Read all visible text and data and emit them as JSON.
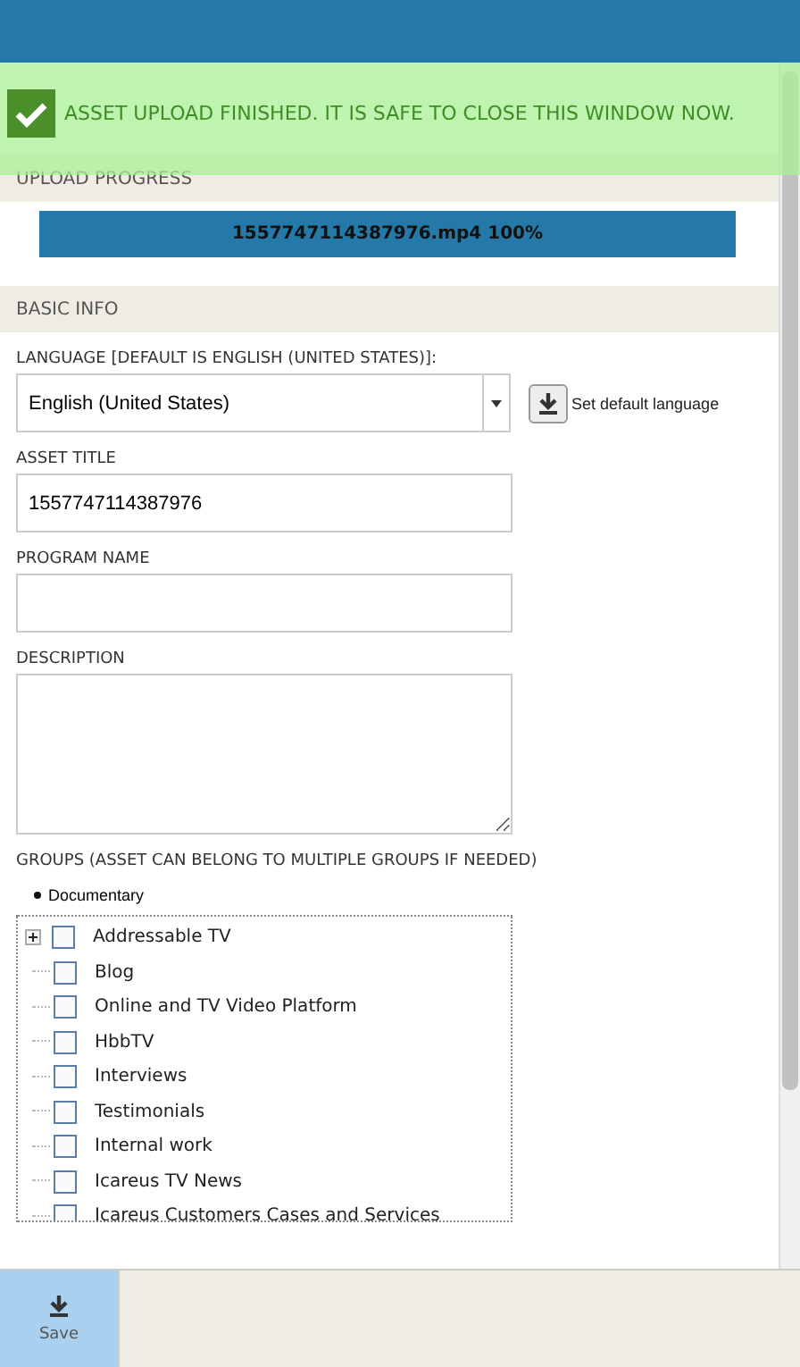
{
  "notification": {
    "text": "ASSET UPLOAD FINISHED. IT IS SAFE TO CLOSE THIS WINDOW NOW."
  },
  "upload_progress": {
    "title": "UPLOAD PROGRESS",
    "label": "1557747114387976.mp4 100%",
    "level": 1
  },
  "basic_info": {
    "title": "BASIC INFO",
    "language": {
      "label": "LANGUAGE [DEFAULT IS ENGLISH (UNITED STATES)]:",
      "value": "English (United States)",
      "default_button": "Set default language"
    },
    "asset_title": {
      "label": "ASSET TITLE",
      "value": "1557747114387976"
    },
    "program_name": {
      "label": "PROGRAM NAME"
    },
    "description": {
      "label": "DESCRIPTION"
    },
    "groups": {
      "label": "GROUPS (ASSET CAN BELONG TO MULTIPLE GROUPS IF NEEDED)",
      "selected_list": [
        "Documentary"
      ],
      "tree": [
        {
          "label": "Addressable TV",
          "checked": false,
          "expandable": true
        },
        {
          "label": "Blog",
          "checked": false,
          "expandable": false
        },
        {
          "label": "Online and TV Video Platform",
          "checked": false,
          "expandable": false
        },
        {
          "label": "HbbTV",
          "checked": false,
          "expandable": false
        },
        {
          "label": "Interviews",
          "checked": false,
          "expandable": false
        },
        {
          "label": "Testimonials",
          "checked": false,
          "expandable": false
        },
        {
          "label": "Internal work",
          "checked": false,
          "expandable": false
        },
        {
          "label": "Icareus TV News",
          "checked": false,
          "expandable": false
        },
        {
          "label": "Icareus Customers Cases and Services",
          "checked": false,
          "expandable": false
        }
      ]
    }
  },
  "footer": {
    "save": "Save"
  }
}
